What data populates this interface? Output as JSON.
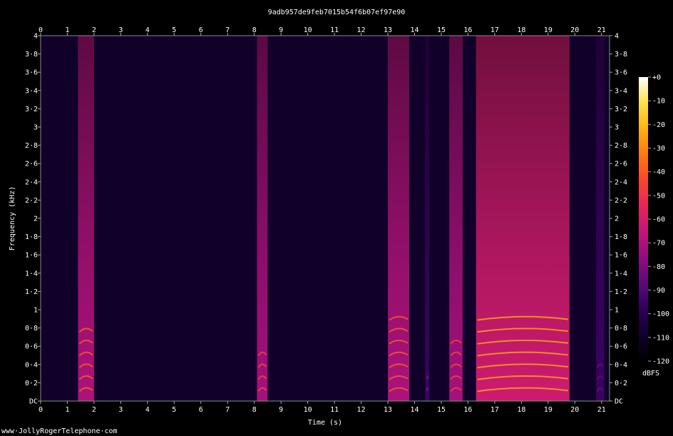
{
  "chart_data": {
    "type": "heatmap",
    "title": "9adb957de9feb7015b54f6b07ef97e90",
    "xlabel": "Time (s)",
    "ylabel": "Frequency (kHz)",
    "xlim": [
      0,
      21.3
    ],
    "ylim": [
      0,
      4
    ],
    "x_ticks": [
      "0",
      "1",
      "2",
      "3",
      "4",
      "5",
      "6",
      "7",
      "8",
      "9",
      "10",
      "11",
      "12",
      "13",
      "14",
      "15",
      "16",
      "17",
      "18",
      "19",
      "20",
      "21"
    ],
    "y_ticks": [
      "DC",
      "0·2",
      "0·4",
      "0·6",
      "0·8",
      "1",
      "1·2",
      "1·4",
      "1·6",
      "1·8",
      "2",
      "2·2",
      "2·4",
      "2·6",
      "2·8",
      "3",
      "3·2",
      "3·4",
      "3·6",
      "3·8",
      "4"
    ],
    "colorbar": {
      "label": "dBFS",
      "ticks": [
        "+0",
        "-10",
        "-20",
        "-30",
        "-40",
        "-50",
        "-60",
        "-70",
        "-80",
        "-90",
        "-100",
        "-110",
        "-120"
      ],
      "range": [
        -120,
        0
      ],
      "colors": [
        "#000000",
        "#12002e",
        "#2c0058",
        "#5a0a78",
        "#8e0d7f",
        "#c2167a",
        "#e6255a",
        "#f5482e",
        "#fb7a12",
        "#fdb10f",
        "#fde24a",
        "#ffffff"
      ]
    },
    "background_level_dbfs": -110,
    "segments": [
      {
        "start": 1.4,
        "end": 2.0,
        "level_dbfs": -70,
        "harmonic_peak_dbfs": -40
      },
      {
        "start": 8.1,
        "end": 8.5,
        "level_dbfs": -72,
        "harmonic_peak_dbfs": -45
      },
      {
        "start": 13.0,
        "end": 13.8,
        "level_dbfs": -70,
        "harmonic_peak_dbfs": -40
      },
      {
        "start": 14.4,
        "end": 14.55,
        "level_dbfs": -95,
        "harmonic_peak_dbfs": -80
      },
      {
        "start": 15.3,
        "end": 15.8,
        "level_dbfs": -72,
        "harmonic_peak_dbfs": -45
      },
      {
        "start": 16.3,
        "end": 19.8,
        "level_dbfs": -62,
        "harmonic_peak_dbfs": -25
      },
      {
        "start": 20.8,
        "end": 21.1,
        "level_dbfs": -95,
        "harmonic_peak_dbfs": -85
      }
    ]
  },
  "footer": {
    "watermark": "www·JollyRogerTelephone·com"
  }
}
